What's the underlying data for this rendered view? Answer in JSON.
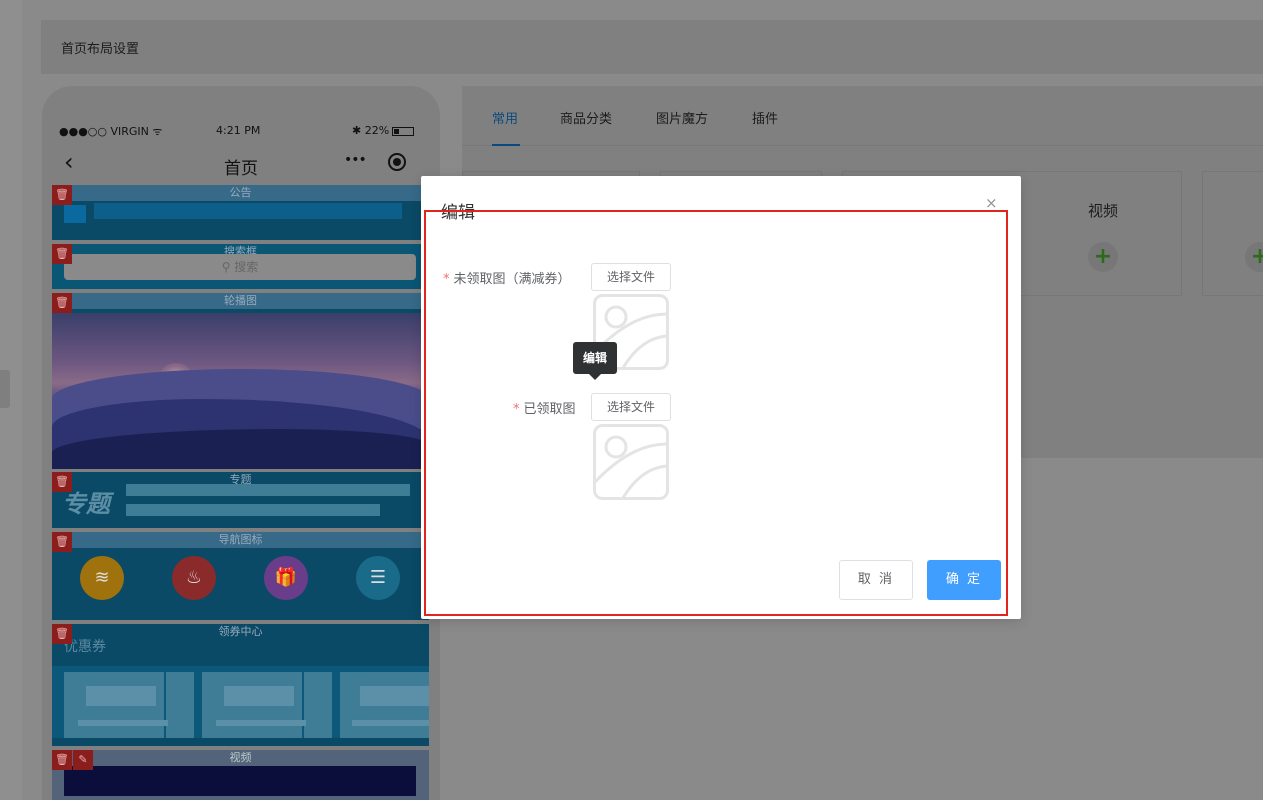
{
  "page": {
    "header_title": "首页布局设置"
  },
  "phone": {
    "status_left": "●●●○○ VIRGIN ᯤ",
    "status_time": "4:21 PM",
    "status_right": "✱ 22%",
    "nav_back": "‹",
    "nav_title": "首页",
    "nav_dots": "•••"
  },
  "blocks": {
    "notice": "公告",
    "search": "搜索框",
    "search_placeholder": "搜索",
    "banner": "轮播图",
    "topic": "专题",
    "topic_logo": "专题",
    "nav_icons": "导航图标",
    "coupon_center": "领券中心",
    "coupon_title": "优惠券",
    "video": "视频",
    "delete_glyph": "🗑",
    "edit_glyph": "✎"
  },
  "tabs": [
    {
      "label": "常用"
    },
    {
      "label": "商品分类"
    },
    {
      "label": "图片魔方"
    },
    {
      "label": "插件"
    }
  ],
  "component_card": {
    "label": "视频",
    "plus": "+"
  },
  "modal": {
    "title": "编辑",
    "close": "×",
    "field1_label": "未领取图（满减券）",
    "field2_label": "已领取图",
    "required_mark": "*",
    "choose_file": "选择文件",
    "tooltip": "编辑",
    "cancel": "取 消",
    "confirm": "确 定"
  },
  "colors": {
    "primary": "#409eff",
    "highlight_frame": "#e0261c",
    "delete_badge": "#8c1d1d"
  },
  "icons": [
    "chevron-left-icon",
    "more-dots-icon",
    "target-icon",
    "trash-icon",
    "edit-icon",
    "search-icon",
    "image-placeholder-icon",
    "plus-icon",
    "close-icon"
  ]
}
